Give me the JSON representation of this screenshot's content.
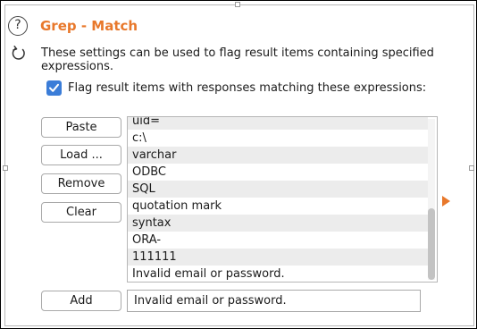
{
  "section": {
    "title": "Grep - Match",
    "description": "These settings can be used to flag result items containing specified expressions."
  },
  "checkbox": {
    "label": "Flag result items with responses matching these expressions:",
    "checked": true
  },
  "buttons": {
    "paste": "Paste",
    "load": "Load ...",
    "remove": "Remove",
    "clear": "Clear",
    "add": "Add"
  },
  "list": {
    "items": [
      "uid=",
      "c:\\",
      "varchar",
      "ODBC",
      "SQL",
      "quotation mark",
      "syntax",
      "ORA-",
      "111111",
      "Invalid email or password."
    ]
  },
  "add_input": {
    "value": "Invalid email or password."
  },
  "icons": {
    "help": "help-circle-icon",
    "refresh": "refresh-icon",
    "expand": "expand-arrow-icon"
  },
  "colors": {
    "accent": "#e8782b",
    "checkbox": "#3b7dd8"
  }
}
